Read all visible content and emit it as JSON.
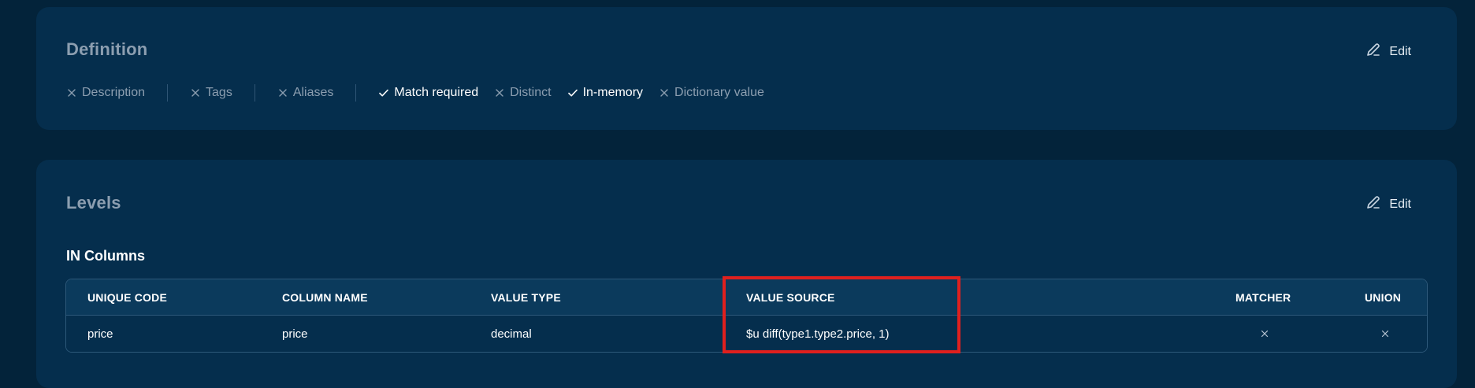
{
  "definition": {
    "title": "Definition",
    "edit_label": "Edit",
    "flags": [
      {
        "label": "Description",
        "state": "off"
      },
      {
        "label": "Tags",
        "state": "off"
      },
      {
        "label": "Aliases",
        "state": "off"
      },
      {
        "label": "Match required",
        "state": "on"
      },
      {
        "label": "Distinct",
        "state": "off"
      },
      {
        "label": "In-memory",
        "state": "on"
      },
      {
        "label": "Dictionary value",
        "state": "off"
      }
    ]
  },
  "levels": {
    "title": "Levels",
    "edit_label": "Edit",
    "section": "IN Columns",
    "table": {
      "headers": [
        "UNIQUE CODE",
        "COLUMN NAME",
        "VALUE TYPE",
        "VALUE SOURCE",
        "MATCHER",
        "UNION"
      ],
      "rows": [
        {
          "unique_code": "price",
          "column_name": "price",
          "value_type": "decimal",
          "value_source": "$u diff(type1.type2.price, 1)",
          "matcher": "x-icon",
          "union": "x-icon"
        }
      ]
    }
  },
  "colors": {
    "background": "#03233a",
    "card": "#052e4d",
    "header_row": "#0b3a5c",
    "muted_text": "#8c9eb0",
    "highlight": "#e0201e"
  }
}
